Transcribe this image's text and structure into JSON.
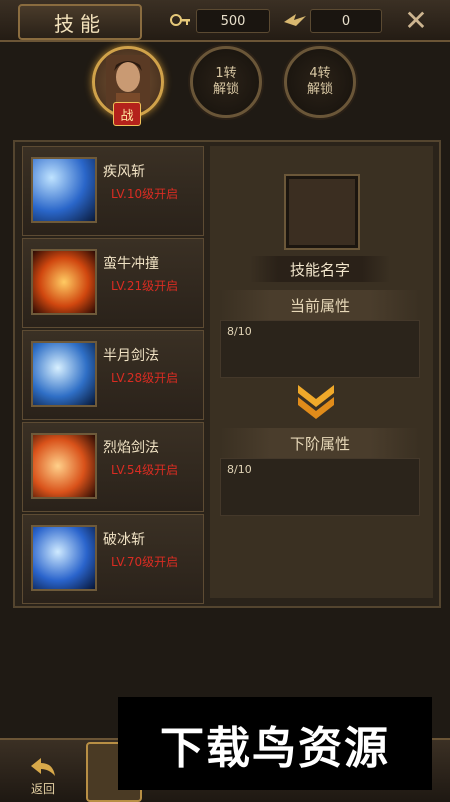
{
  "header": {
    "title": "技能",
    "resource_key": {
      "value": "500",
      "icon": "key-icon"
    },
    "resource_wing": {
      "value": "0",
      "icon": "wing-icon"
    },
    "close_icon": "close-icon"
  },
  "classes": [
    {
      "label": "战",
      "active": true
    },
    {
      "line1": "1转",
      "line2": "解锁",
      "active": false
    },
    {
      "line1": "4转",
      "line2": "解锁",
      "active": false
    }
  ],
  "skills": [
    {
      "name": "疾风斩",
      "level": "LV.10级开启",
      "color": "#3a7fd6"
    },
    {
      "name": "蛮牛冲撞",
      "level": "LV.21级开启",
      "color": "#d85a18"
    },
    {
      "name": "半月剑法",
      "level": "LV.28级开启",
      "color": "#2f7bd0"
    },
    {
      "name": "烈焰剑法",
      "level": "LV.54级开启",
      "color": "#e0621a"
    },
    {
      "name": "破冰斩",
      "level": "LV.70级开启",
      "color": "#2c6fd4"
    }
  ],
  "detail": {
    "skill_name": "技能名字",
    "current_label": "当前属性",
    "current_value": "8/10",
    "next_label": "下阶属性",
    "next_value": "8/10"
  },
  "footer": {
    "back_label": "返回"
  },
  "watermark": "下载鸟资源"
}
